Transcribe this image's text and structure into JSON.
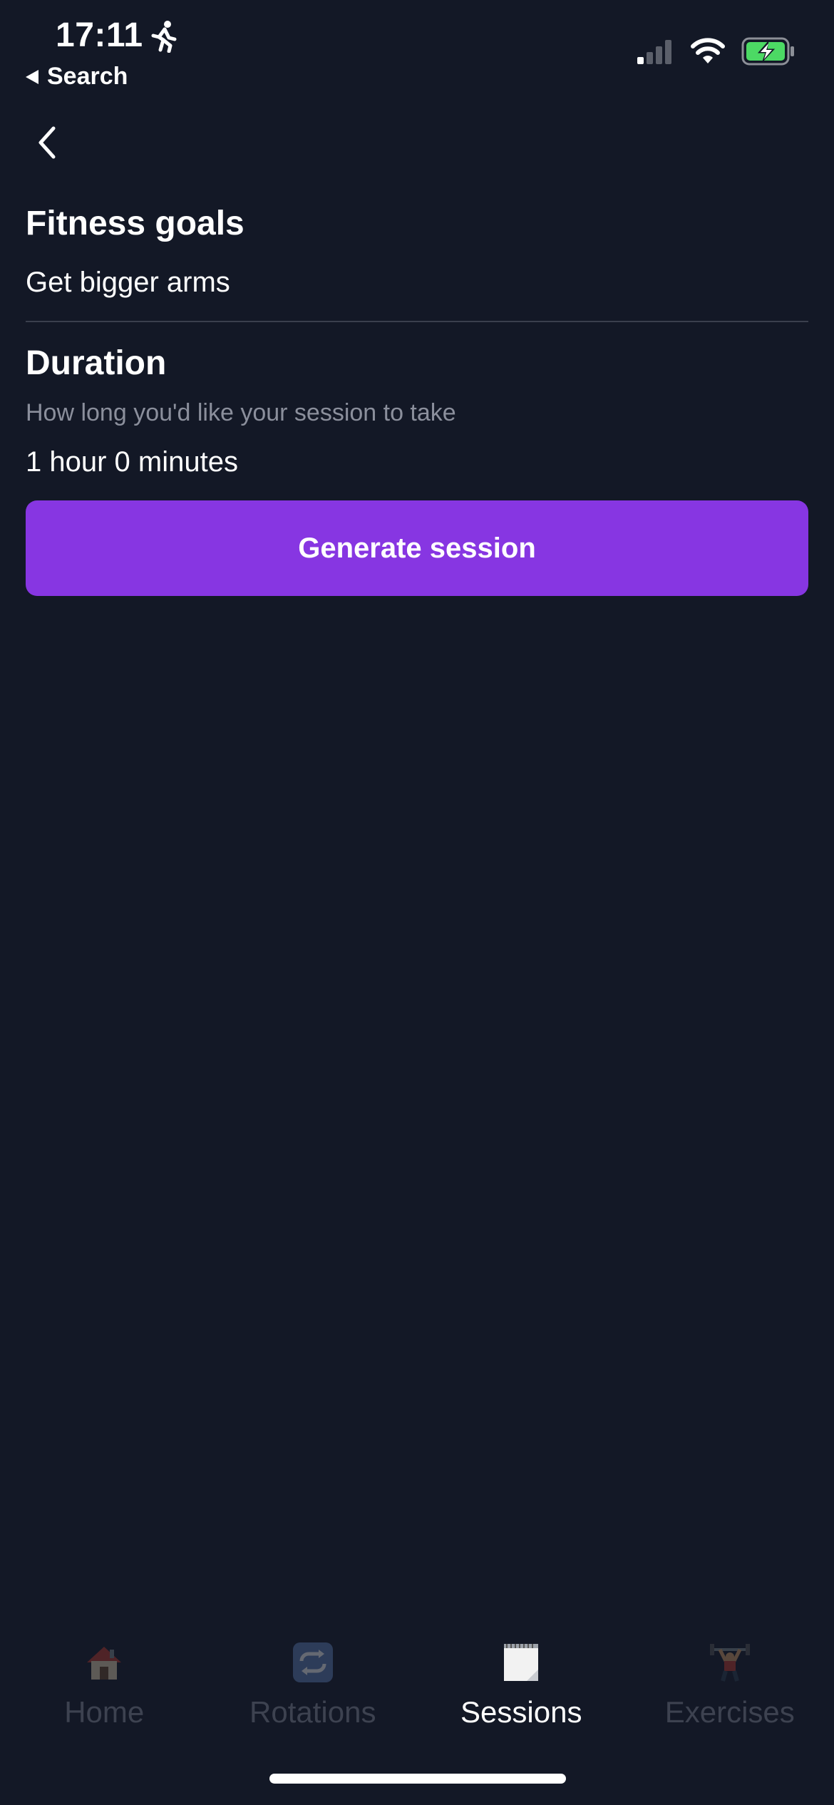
{
  "status_bar": {
    "time": "17:11",
    "back_app_label": "Search",
    "icons": [
      "runner-icon",
      "cellular-signal-icon",
      "wifi-icon",
      "battery-charging-icon"
    ]
  },
  "nav": {
    "back_icon": "chevron-left-icon"
  },
  "fitness_goals": {
    "title": "Fitness goals",
    "value": "Get bigger arms"
  },
  "duration": {
    "title": "Duration",
    "hint": "How long you'd like your session to take",
    "value": "1 hour 0 minutes"
  },
  "generate_button": {
    "label": "Generate session"
  },
  "tab_bar": {
    "tabs": [
      {
        "label": "Home",
        "icon": "house-icon",
        "active": false
      },
      {
        "label": "Rotations",
        "icon": "repeat-icon",
        "active": false
      },
      {
        "label": "Sessions",
        "icon": "notepad-icon",
        "active": true
      },
      {
        "label": "Exercises",
        "icon": "weightlifter-icon",
        "active": false
      }
    ]
  },
  "colors": {
    "background": "#131826",
    "accent": "#8736e2",
    "muted_text": "#8b8f9c",
    "inactive_tab": "#3d4250",
    "battery_green": "#4cd964"
  }
}
